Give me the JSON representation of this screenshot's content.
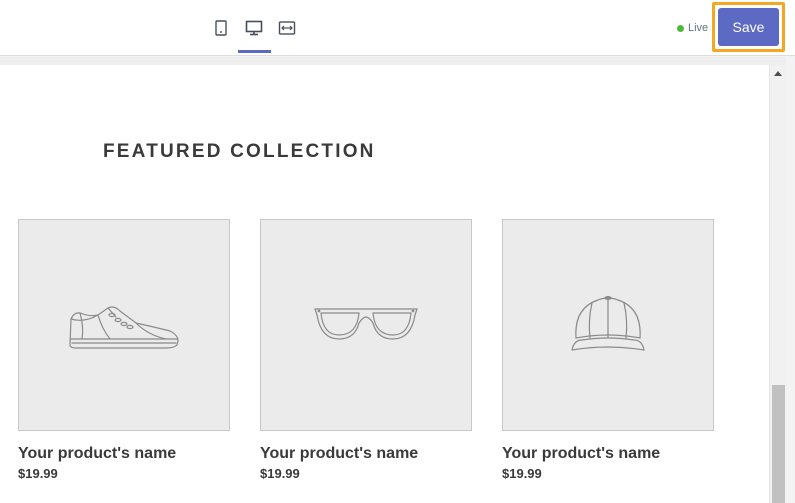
{
  "toolbar": {
    "device_icons": [
      "mobile-icon",
      "desktop-icon",
      "full-width-icon"
    ],
    "active_device": "desktop-icon",
    "status_label": "Live",
    "save_label": "Save"
  },
  "colors": {
    "accent": "#5c6ac4",
    "live_dot": "#50b83c",
    "highlight": "#f5a623"
  },
  "preview": {
    "section_title": "FEATURED COLLECTION",
    "products": [
      {
        "icon": "sneaker-icon",
        "name": "Your product's name",
        "price": "$19.99"
      },
      {
        "icon": "sunglasses-icon",
        "name": "Your product's name",
        "price": "$19.99"
      },
      {
        "icon": "cap-icon",
        "name": "Your product's name",
        "price": "$19.99"
      }
    ]
  }
}
